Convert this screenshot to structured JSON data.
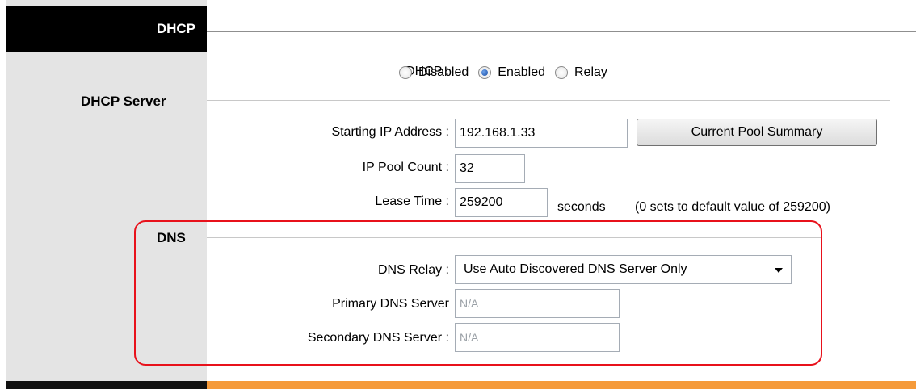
{
  "section_header": {
    "title": "DHCP"
  },
  "dhcp_server": {
    "section_title": "DHCP Server",
    "dhcp_label": "DHCP :",
    "options": [
      "Disabled",
      "Enabled",
      "Relay"
    ],
    "selected": "Enabled",
    "starting_ip_label": "Starting IP Address :",
    "starting_ip_value": "192.168.1.33",
    "pool_summary_button": "Current Pool Summary",
    "pool_count_label": "IP Pool Count :",
    "pool_count_value": "32",
    "lease_time_label": "Lease Time :",
    "lease_time_value": "259200",
    "lease_time_unit": "seconds",
    "lease_time_note": "(0 sets to default value of 259200)"
  },
  "dns": {
    "section_title": "DNS",
    "relay_label": "DNS Relay :",
    "relay_value": "Use Auto Discovered DNS Server Only",
    "primary_label": "Primary DNS Server",
    "primary_value": "N/A",
    "secondary_label": "Secondary DNS Server :",
    "secondary_value": "N/A"
  },
  "colors": {
    "highlight": "#e8111b",
    "footer_accent": "#f59a3a",
    "sidebar_bg": "#e4e4e4"
  }
}
